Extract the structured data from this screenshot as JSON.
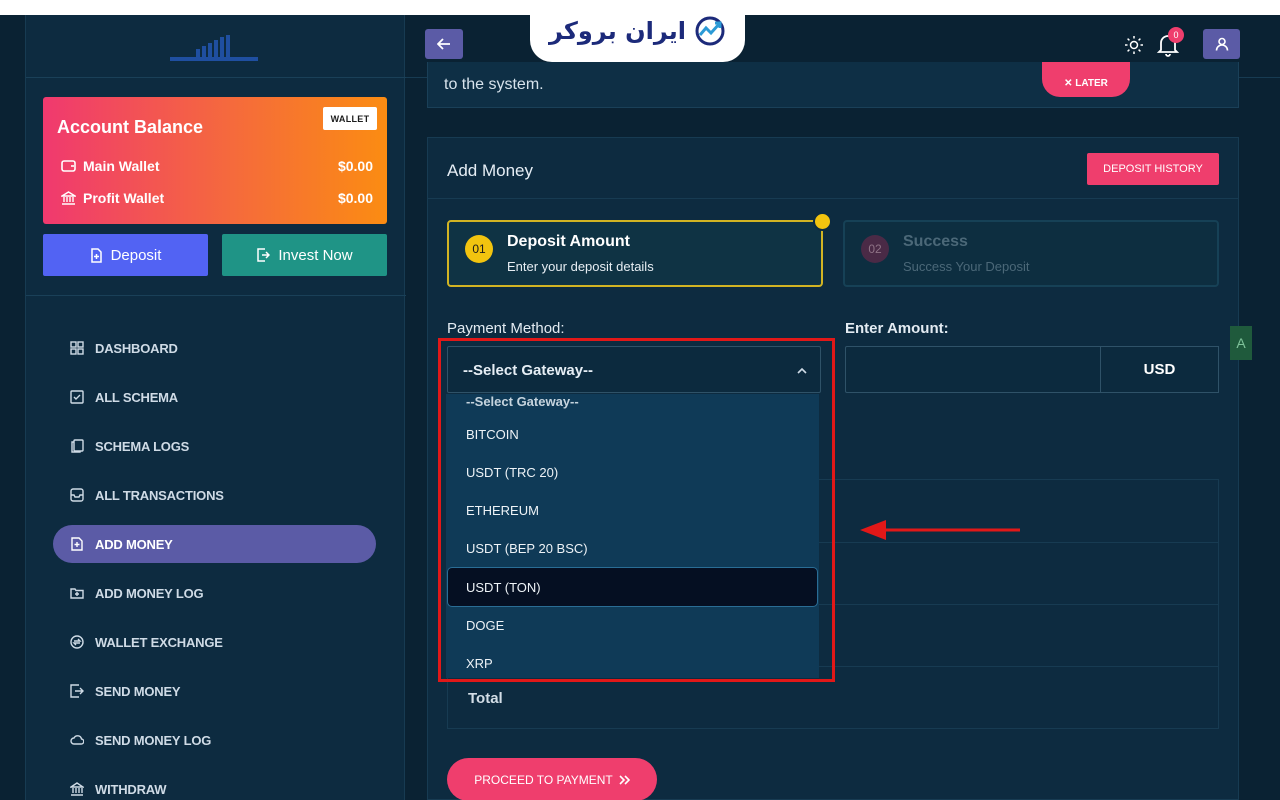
{
  "brand": {
    "logo_text": "ایران بروکر"
  },
  "sidebar": {
    "balance": {
      "title": "Account Balance",
      "wallet_badge": "WALLET",
      "main_label": "Main Wallet",
      "main_value": "$0.00",
      "profit_label": "Profit Wallet",
      "profit_value": "$0.00"
    },
    "deposit_label": "Deposit",
    "invest_label": "Invest Now",
    "nav": [
      {
        "label": "DASHBOARD",
        "icon": "grid-icon"
      },
      {
        "label": "ALL SCHEMA",
        "icon": "checkbox-icon"
      },
      {
        "label": "SCHEMA LOGS",
        "icon": "copy-icon"
      },
      {
        "label": "ALL TRANSACTIONS",
        "icon": "inbox-icon"
      },
      {
        "label": "ADD MONEY",
        "icon": "file-plus-icon",
        "active": true
      },
      {
        "label": "ADD MONEY LOG",
        "icon": "folder-plus-icon"
      },
      {
        "label": "WALLET EXCHANGE",
        "icon": "exchange-icon"
      },
      {
        "label": "SEND MONEY",
        "icon": "log-out-icon"
      },
      {
        "label": "SEND MONEY LOG",
        "icon": "cloud-icon"
      },
      {
        "label": "WITHDRAW",
        "icon": "bank-icon"
      }
    ]
  },
  "header": {
    "notification_count": "0"
  },
  "notice": {
    "text": "to the system.",
    "later_label": "✕ LATER"
  },
  "card": {
    "title": "Add Money",
    "history_label": "DEPOSIT HISTORY",
    "steps": [
      {
        "num": "01",
        "title": "Deposit Amount",
        "subtitle": "Enter your deposit details"
      },
      {
        "num": "02",
        "title": "Success",
        "subtitle": "Success Your Deposit"
      }
    ],
    "payment_label": "Payment Method:",
    "amount_label": "Enter Amount:",
    "select_value": "--Select Gateway--",
    "amount_value": "",
    "currency": "USD",
    "total_label": "Total",
    "proceed_label": "PROCEED TO PAYMENT"
  },
  "dropdown": {
    "options": [
      "--Select Gateway--",
      "BITCOIN",
      "USDT (TRC 20)",
      "ETHEREUM",
      "USDT (BEP 20 BSC)",
      "USDT (TON)",
      "DOGE",
      "XRP"
    ],
    "highlighted": "USDT (TON)"
  },
  "colors": {
    "background": "#0a2233",
    "accent_pink": "#ef3e6d",
    "accent_purple": "#5b5ba6",
    "deposit_blue": "#5263f3",
    "invest_teal": "#1f9486",
    "step_yellow": "#f2c40f",
    "annotation_red": "#e11818"
  }
}
